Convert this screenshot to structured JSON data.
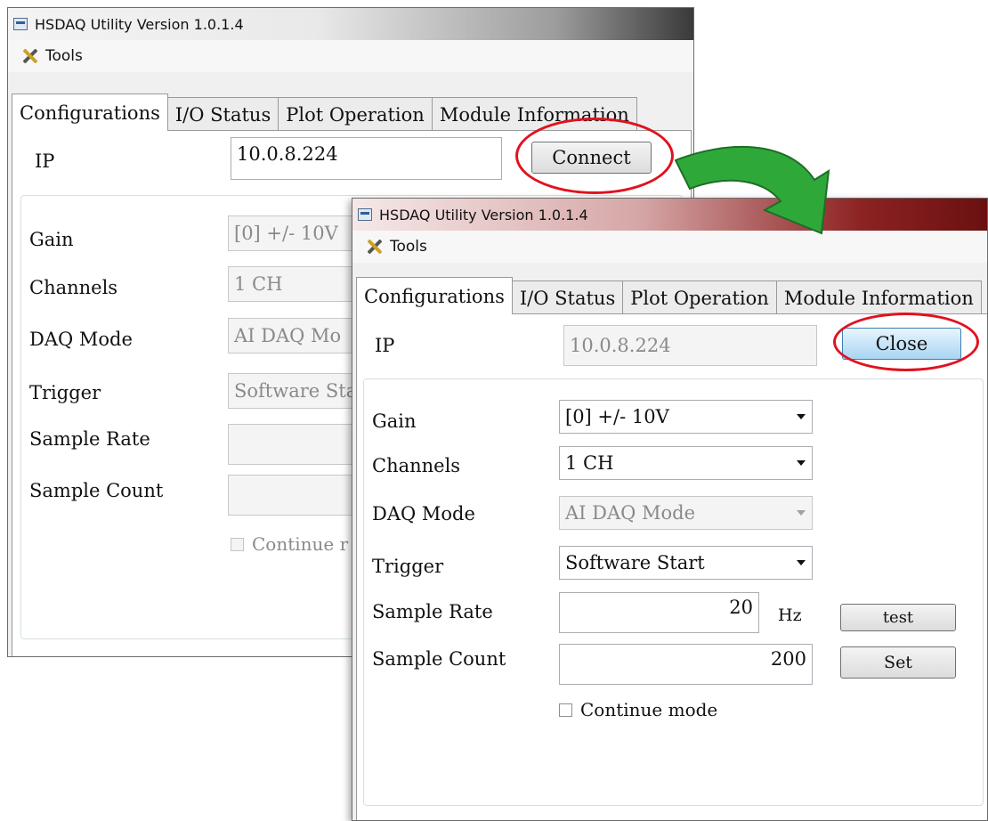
{
  "app_title": "HSDAQ Utility Version 1.0.1.4",
  "menu": {
    "tools_label": "Tools"
  },
  "tabs": [
    "Configurations",
    "I/O Status",
    "Plot Operation",
    "Module Information"
  ],
  "before": {
    "ip_label": "IP",
    "ip_value": "10.0.8.224",
    "connect_label": "Connect",
    "gain_label": "Gain",
    "gain_value": "[0] +/- 10V",
    "channels_label": "Channels",
    "channels_value": "1 CH",
    "daq_mode_label": "DAQ Mode",
    "daq_mode_value": "AI DAQ Mo",
    "trigger_label": "Trigger",
    "trigger_value": "Software Sta",
    "sample_rate_label": "Sample Rate",
    "sample_count_label": "Sample Count",
    "continue_label": "Continue r"
  },
  "after": {
    "ip_label": "IP",
    "ip_value": "10.0.8.224",
    "close_label": "Close",
    "gain_label": "Gain",
    "gain_value": "[0] +/- 10V",
    "channels_label": "Channels",
    "channels_value": "1 CH",
    "daq_mode_label": "DAQ Mode",
    "daq_mode_value": "AI DAQ Mode",
    "trigger_label": "Trigger",
    "trigger_value": "Software Start",
    "sample_rate_label": "Sample Rate",
    "sample_rate_value": "20",
    "sample_rate_unit": "Hz",
    "test_label": "test",
    "sample_count_label": "Sample Count",
    "sample_count_value": "200",
    "set_label": "Set",
    "continue_label": "Continue mode"
  },
  "colors": {
    "highlight": "#e0121f",
    "arrow": "#2fa83a",
    "close_button": "#a9d5f3"
  }
}
